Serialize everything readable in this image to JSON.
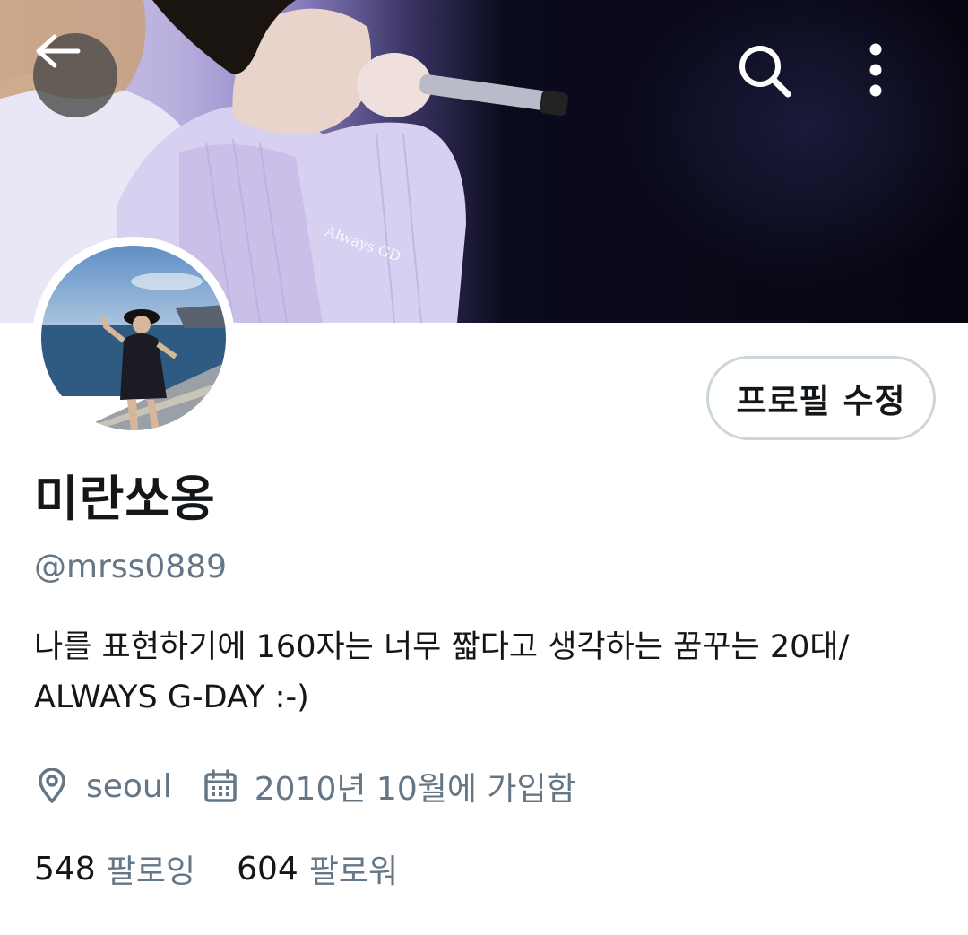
{
  "header": {
    "back_icon": "arrow-left-icon",
    "search_icon": "search-icon",
    "more_icon": "more-vertical-icon",
    "banner_watermark": "Always GD"
  },
  "profile": {
    "edit_button_label": "프로필 수정",
    "display_name": "미란쏘옹",
    "handle": "@mrss0889",
    "bio_lines": [
      "나를 표현하기에 160자는 너무 짧다고 생각하는 꿈꾸는 20대/",
      "ALWAYS G-DAY :-)"
    ],
    "location_icon": "location-pin-icon",
    "location": "seoul",
    "joined_icon": "calendar-icon",
    "joined": "2010년 10월에 가입함",
    "following_count": "548",
    "following_label": "팔로잉",
    "followers_count": "604",
    "followers_label": "팔로워"
  },
  "colors": {
    "text_primary": "#14171a",
    "text_secondary": "#657786",
    "button_border": "#ccd6dd",
    "back_button_bg": "#464646"
  }
}
